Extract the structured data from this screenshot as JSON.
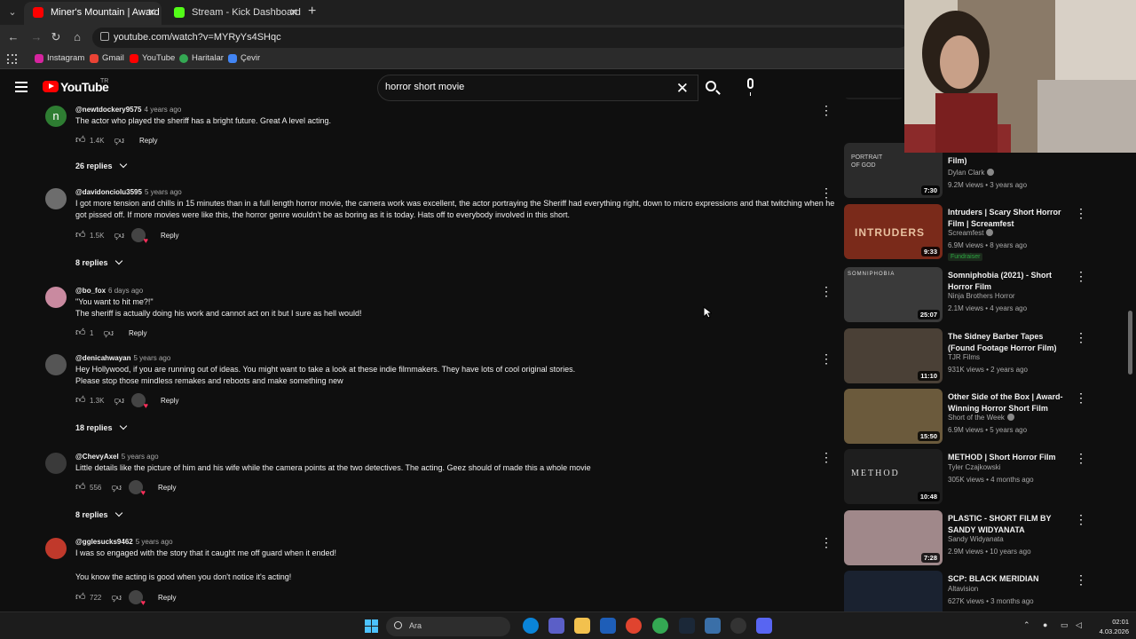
{
  "browser": {
    "tabs": [
      {
        "title": "Miner's Mountain | Award Winni",
        "active": true,
        "favicon": "youtube-favicon"
      },
      {
        "title": "Stream - Kick Dashboard",
        "active": false,
        "favicon": "kick-favicon"
      }
    ],
    "url": "youtube.com/watch?v=MYRyYs4SHqc",
    "bookmarks": [
      "Instagram",
      "Gmail",
      "YouTube",
      "Haritalar",
      "Çevir"
    ]
  },
  "youtube": {
    "wordmark": "YouTube",
    "country_code": "TR",
    "search_value": "horror short movie"
  },
  "comments": [
    {
      "author": "@newtdockery9575",
      "time": "4 years ago",
      "text": "The actor who played the sheriff has a bright future. Great A level acting.",
      "likes": "1.4K",
      "reply": "Reply",
      "replies": "26 replies",
      "heart": false,
      "avatar_letter": "n",
      "avatar_color": "#2e7d32"
    },
    {
      "author": "@davidonciolu3595",
      "time": "5 years ago",
      "text": "I got more tension and chills in 15 minutes than in a full length horror movie, the camera work was excellent, the actor portraying the Sheriff had everything right, down to micro expressions and that twitching when he got pissed off. If more movies were like this, the horror genre wouldn't be as boring as it is today. Hats off to everybody involved in this short.",
      "likes": "1.5K",
      "reply": "Reply",
      "replies": "8 replies",
      "heart": true,
      "avatar_letter": "",
      "avatar_color": "#6d6d6d"
    },
    {
      "author": "@bo_fox",
      "time": "6 days ago",
      "text_lines": [
        "\"You want to hit me?!\"",
        "The sheriff is actually doing his work and cannot act on it but I sure as hell would!"
      ],
      "likes": "1",
      "reply": "Reply",
      "replies": "",
      "heart": false,
      "avatar_letter": "",
      "avatar_color": "#c98aa0"
    },
    {
      "author": "@denicahwayan",
      "time": "5 years ago",
      "text_lines": [
        "Hey Hollywood, if you are running out of ideas. You might want to take a look at these indie filmmakers. They have lots of cool original stories.",
        "Please stop those mindless remakes and reboots and make something new"
      ],
      "likes": "1.3K",
      "reply": "Reply",
      "replies": "18 replies",
      "heart": true,
      "avatar_letter": "",
      "avatar_color": "#555555"
    },
    {
      "author": "@ChevyAxel",
      "time": "5 years ago",
      "text": "Little details like the picture of him and his wife while the camera points at the two detectives. The acting. Geez should of made this a whole movie",
      "likes": "556",
      "reply": "Reply",
      "replies": "8 replies",
      "heart": true,
      "avatar_letter": "",
      "avatar_color": "#3a3a3a"
    },
    {
      "author": "@gglesucks9462",
      "time": "5 years ago",
      "text_lines": [
        "I was so engaged with the story that it caught me off guard when it ended!",
        "",
        "You know the acting is good when you don't notice it's acting!"
      ],
      "likes": "722",
      "reply": "Reply",
      "replies": "",
      "heart": true,
      "avatar_letter": "",
      "avatar_color": "#c0392b"
    }
  ],
  "related": [
    {
      "title": "Film)",
      "channel": "Dylan Clark",
      "verified": true,
      "meta": "9.2M views • 3 years ago",
      "duration": "7:30",
      "thumb_color": "#2b2b2b",
      "thumb_text": "PORTRAIT OF GOD"
    },
    {
      "title": "Intruders | Scary Short Horror Film | Screamfest",
      "channel": "Screamfest",
      "verified": true,
      "meta": "6.9M views • 8 years ago",
      "badge": "Fundraiser",
      "duration": "9:33",
      "thumb_color": "#7a2a1a",
      "thumb_text": "INTRUDERS"
    },
    {
      "title": "Somniphobia (2021) - Short Horror Film",
      "channel": "Ninja Brothers Horror",
      "verified": false,
      "meta": "2.1M views • 4 years ago",
      "duration": "25:07",
      "thumb_color": "#3a3a3a",
      "thumb_text": "SOMNIPHOBIA"
    },
    {
      "title": "The Sidney Barber Tapes (Found Footage Horror Film)",
      "channel": "TJR Films",
      "verified": false,
      "meta": "931K views • 2 years ago",
      "duration": "11:10",
      "thumb_color": "#4a4036",
      "thumb_text": ""
    },
    {
      "title": "Other Side of the Box | Award-Winning Horror Short Film",
      "channel": "Short of the Week",
      "verified": true,
      "meta": "6.9M views • 5 years ago",
      "duration": "15:50",
      "thumb_color": "#6b5a3c",
      "thumb_text": ""
    },
    {
      "title": "METHOD | Short Horror Film",
      "channel": "Tyler Czajkowski",
      "verified": false,
      "meta": "305K views • 4 months ago",
      "duration": "10:48",
      "thumb_color": "#1e1e1e",
      "thumb_text": "METHOD"
    },
    {
      "title": "PLASTIC - SHORT FILM BY SANDY WIDYANATA",
      "channel": "Sandy Widyanata",
      "verified": false,
      "meta": "2.9M views • 10 years ago",
      "duration": "7:28",
      "thumb_color": "#a0888a",
      "thumb_text": ""
    },
    {
      "title": "SCP: BLACK MERIDIAN",
      "channel": "Altavision",
      "verified": false,
      "meta": "627K views • 3 months ago",
      "duration": "",
      "thumb_color": "#1a2230",
      "thumb_text": ""
    }
  ],
  "taskbar": {
    "search_placeholder": "Ara",
    "time": "02:01",
    "date": "4.03.2026"
  },
  "colors": {
    "background": "#0f0f0f",
    "youtube_red": "#ff0000",
    "heart": "#ff2e5a",
    "fundraiser_green": "#2ba640"
  }
}
